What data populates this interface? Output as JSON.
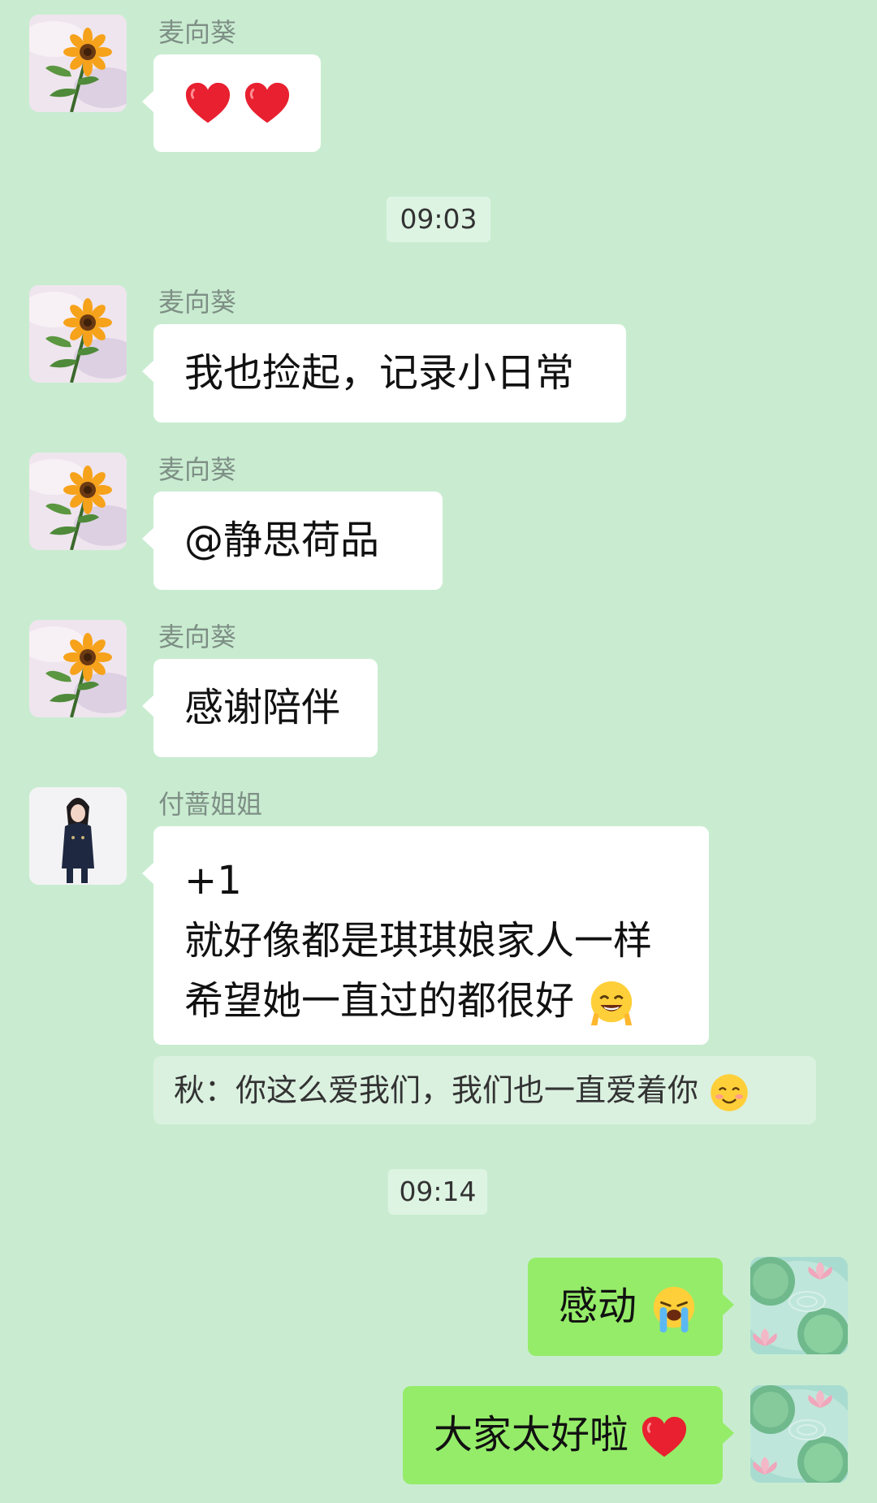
{
  "colors": {
    "background": "#c9ecd1",
    "bubble_incoming": "#ffffff",
    "bubble_outgoing": "#95ec69",
    "sender_name": "#7e8f85",
    "timestamp_bg": "#def4e3"
  },
  "messages": [
    {
      "sender": "麦向葵",
      "avatar": "sunflower-avatar",
      "icons": [
        "red-heart-icon",
        "red-heart-icon"
      ]
    },
    {
      "timestamp": "09:03"
    },
    {
      "sender": "麦向葵",
      "avatar": "sunflower-avatar",
      "text": "我也捡起，记录小日常"
    },
    {
      "sender": "麦向葵",
      "avatar": "sunflower-avatar",
      "text": "@静思荷品"
    },
    {
      "sender": "麦向葵",
      "avatar": "sunflower-avatar",
      "text": "感谢陪伴"
    },
    {
      "sender": "付蔷姐姐",
      "avatar": "woman-photo-avatar",
      "lines": [
        "+1",
        "就好像都是琪琪娘家人一样",
        "希望她一直过的都很好"
      ],
      "trailing_icon": "grinning-peace-sign-emoji",
      "quote": {
        "text": "秋：你这么爱我们，我们也一直爱着你",
        "icon": "smiling-face-emoji"
      }
    },
    {
      "timestamp": "09:14"
    },
    {
      "self": true,
      "avatar": "lotus-pond-avatar",
      "text": "感动",
      "icon": "loudly-crying-face-emoji"
    },
    {
      "self": true,
      "avatar": "lotus-pond-avatar",
      "text": "大家太好啦",
      "icon": "red-heart-icon"
    }
  ]
}
